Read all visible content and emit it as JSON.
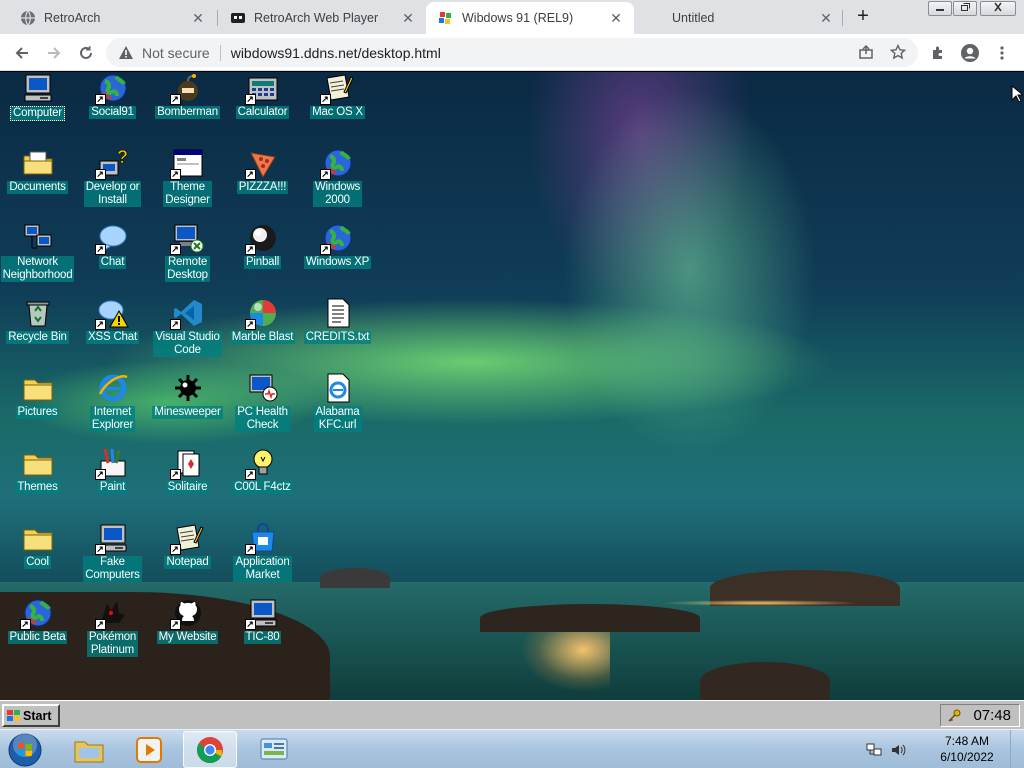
{
  "browser": {
    "tabs": [
      {
        "title": "RetroArch",
        "icon": "globe-icon",
        "active": false
      },
      {
        "title": "RetroArch Web Player",
        "icon": "retroarch-icon",
        "active": false
      },
      {
        "title": "Wibdows 91 (REL9)",
        "icon": "wibdows-icon",
        "active": true
      },
      {
        "title": "Untitled",
        "icon": "",
        "active": false
      }
    ],
    "close_glyph": "✕",
    "new_tab_glyph": "+",
    "security_label": "Not secure",
    "url": "wibdows91.ddns.net/desktop.html"
  },
  "desktop": {
    "icons": [
      {
        "label": "Computer",
        "icon": "computer-icon",
        "shortcut": false,
        "selected": true
      },
      {
        "label": "Social91",
        "icon": "globe-icon",
        "shortcut": true
      },
      {
        "label": "Bomberman",
        "icon": "bomberman-icon",
        "shortcut": true
      },
      {
        "label": "Calculator",
        "icon": "calculator-icon",
        "shortcut": true
      },
      {
        "label": "Mac OS X",
        "icon": "notepad-icon",
        "shortcut": true
      },
      {
        "label": "Documents",
        "icon": "documents-folder-icon",
        "shortcut": false
      },
      {
        "label": "Develop or\nInstall",
        "icon": "help-icon",
        "shortcut": true
      },
      {
        "label": "Theme\nDesigner",
        "icon": "window-icon",
        "shortcut": true
      },
      {
        "label": "PIZZZA!!!",
        "icon": "pizza-icon",
        "shortcut": true
      },
      {
        "label": "Windows\n2000",
        "icon": "globe-icon",
        "shortcut": true
      },
      {
        "label": "Network\nNeighborhood",
        "icon": "network-icon",
        "shortcut": false
      },
      {
        "label": "Chat",
        "icon": "chat-bubble-icon",
        "shortcut": true
      },
      {
        "label": "Remote\nDesktop",
        "icon": "remote-desktop-icon",
        "shortcut": true
      },
      {
        "label": "Pinball",
        "icon": "pinball-icon",
        "shortcut": true
      },
      {
        "label": "Windows XP",
        "icon": "globe-icon",
        "shortcut": true
      },
      {
        "label": "Recycle Bin",
        "icon": "recycle-bin-icon",
        "shortcut": false
      },
      {
        "label": "XSS Chat",
        "icon": "warning-chat-icon",
        "shortcut": true
      },
      {
        "label": "Visual Studio\nCode",
        "icon": "vscode-icon",
        "shortcut": true
      },
      {
        "label": "Marble Blast",
        "icon": "marble-icon",
        "shortcut": true
      },
      {
        "label": "CREDITS.txt",
        "icon": "text-file-icon",
        "shortcut": false
      },
      {
        "label": "Pictures",
        "icon": "folder-icon",
        "shortcut": false
      },
      {
        "label": "Internet\nExplorer",
        "icon": "internet-explorer-icon",
        "shortcut": false
      },
      {
        "label": "Minesweeper",
        "icon": "mine-icon",
        "shortcut": false
      },
      {
        "label": "PC Health\nCheck",
        "icon": "pc-health-icon",
        "shortcut": false
      },
      {
        "label": "Alabama\nKFC.url",
        "icon": "url-file-icon",
        "shortcut": false
      },
      {
        "label": "Themes",
        "icon": "folder-icon",
        "shortcut": false
      },
      {
        "label": "Paint",
        "icon": "paint-icon",
        "shortcut": true
      },
      {
        "label": "Solitaire",
        "icon": "solitaire-icon",
        "shortcut": true
      },
      {
        "label": "C00L F4ctz",
        "icon": "lightbulb-icon",
        "shortcut": true
      },
      {
        "label": "Cool",
        "icon": "folder-icon",
        "shortcut": false
      },
      {
        "label": "Fake\nComputers",
        "icon": "computer-icon",
        "shortcut": true
      },
      {
        "label": "Notepad",
        "icon": "notepad-icon",
        "shortcut": true
      },
      {
        "label": "Application\nMarket",
        "icon": "app-market-icon",
        "shortcut": true
      },
      {
        "label": "Public Beta",
        "icon": "globe-icon",
        "shortcut": true
      },
      {
        "label": "Pokémon\nPlatinum",
        "icon": "pokemon-icon",
        "shortcut": true
      },
      {
        "label": "My Website",
        "icon": "github-icon",
        "shortcut": true
      },
      {
        "label": "TIC-80",
        "icon": "computer-icon",
        "shortcut": true
      }
    ]
  },
  "win98_taskbar": {
    "start_label": "Start",
    "clock": "07:48"
  },
  "host_taskbar": {
    "time": "7:48 AM",
    "date": "6/10/2022"
  },
  "colors": {
    "icon_label_bg": "#008080",
    "taskbar98": "#c0c0c0",
    "chrome_tabstrip": "#dfe1e5"
  }
}
